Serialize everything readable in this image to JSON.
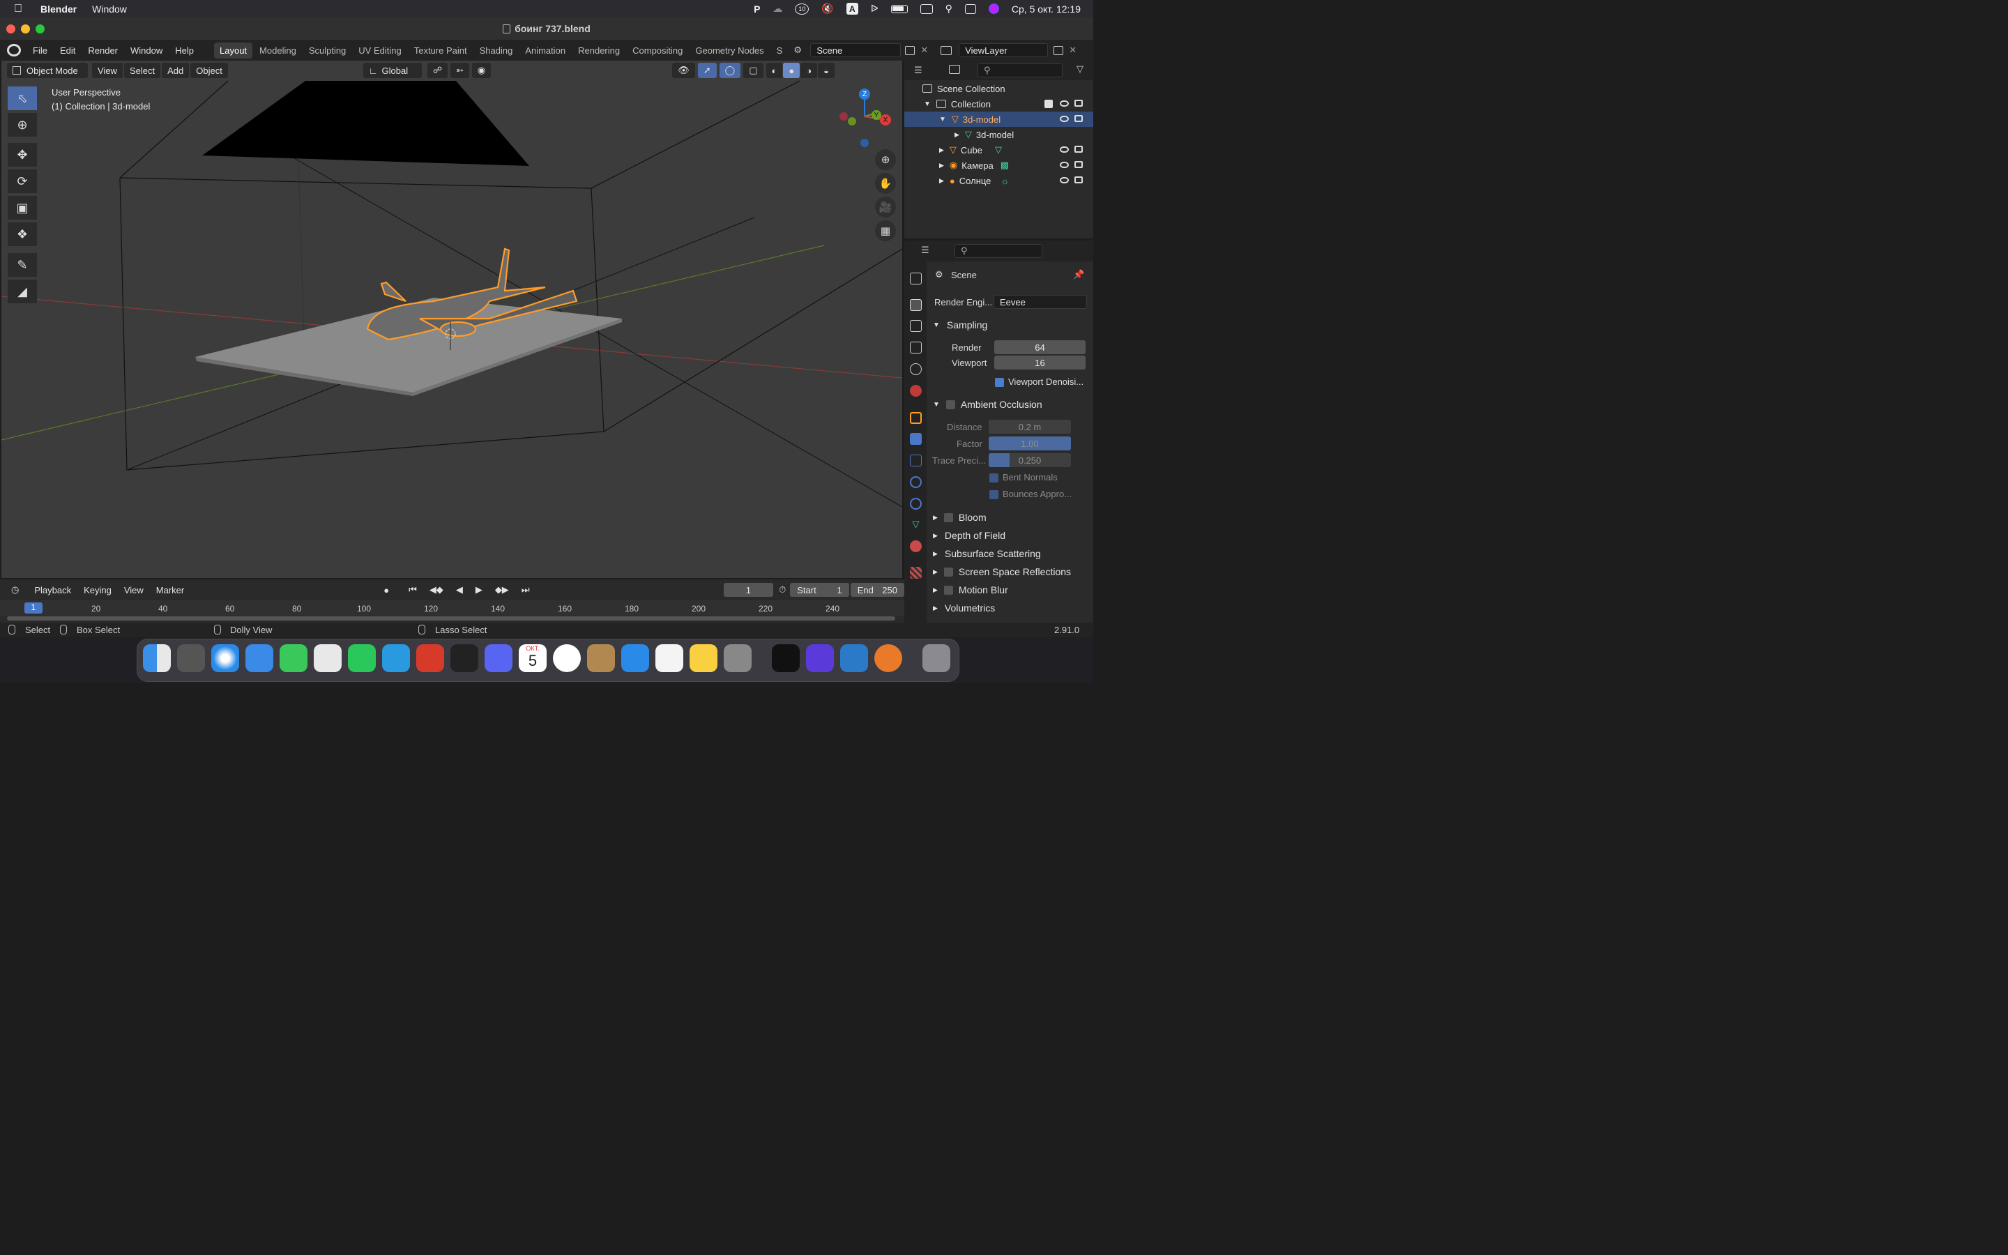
{
  "menubar": {
    "app_name": "Blender",
    "menus": [
      "Window"
    ],
    "clock": "Ср, 5 окт.  12:19",
    "tray_badge": "10",
    "input_letter": "A"
  },
  "window": {
    "title": "боинг 737.blend"
  },
  "topbar": {
    "menus": [
      "File",
      "Edit",
      "Render",
      "Window",
      "Help"
    ],
    "workspaces": [
      "Layout",
      "Modeling",
      "Sculpting",
      "UV Editing",
      "Texture Paint",
      "Shading",
      "Animation",
      "Rendering",
      "Compositing",
      "Geometry Nodes",
      "S"
    ],
    "active_workspace": "Layout",
    "scene_name": "Scene",
    "view_layer": "ViewLayer"
  },
  "viewport": {
    "mode": "Object Mode",
    "menus": [
      "View",
      "Select",
      "Add",
      "Object"
    ],
    "orientation": "Global",
    "info_line1": "User Perspective",
    "info_line2": "(1) Collection | 3d-model",
    "gizmo": {
      "z": "Z",
      "y": "Y",
      "x": "X"
    }
  },
  "outliner": {
    "root": "Scene Collection",
    "items": [
      {
        "label": "Collection",
        "depth": 1
      },
      {
        "label": "3d-model",
        "depth": 2,
        "selected": true
      },
      {
        "label": "3d-model",
        "depth": 3
      },
      {
        "label": "Cube",
        "depth": 2
      },
      {
        "label": "Камера",
        "depth": 2
      },
      {
        "label": "Солнце",
        "depth": 2
      }
    ]
  },
  "properties": {
    "context": "Scene",
    "render_engine_label": "Render Engi...",
    "render_engine": "Eevee",
    "sampling": {
      "title": "Sampling",
      "render_label": "Render",
      "render": "64",
      "viewport_label": "Viewport",
      "viewport": "16",
      "denoise_label": "Viewport Denoisi..."
    },
    "ao": {
      "title": "Ambient Occlusion",
      "distance_label": "Distance",
      "distance": "0.2 m",
      "factor_label": "Factor",
      "factor": "1.00",
      "factor_fill": 1.0,
      "trace_label": "Trace Preci...",
      "trace": "0.250",
      "trace_fill": 0.25,
      "bent_label": "Bent Normals",
      "bounces_label": "Bounces Appro..."
    },
    "sections": [
      "Bloom",
      "Depth of Field",
      "Subsurface Scattering",
      "Screen Space Reflections",
      "Motion Blur",
      "Volumetrics"
    ]
  },
  "timeline": {
    "menus": [
      "Playback",
      "Keying",
      "View",
      "Marker"
    ],
    "current_frame": "1",
    "start_label": "Start",
    "start": "1",
    "end_label": "End",
    "end": "250",
    "ruler": [
      "1",
      "20",
      "40",
      "60",
      "80",
      "100",
      "120",
      "140",
      "160",
      "180",
      "200",
      "220",
      "240"
    ]
  },
  "statusbar": {
    "items": [
      "Select",
      "Box Select",
      "Dolly View",
      "Lasso Select"
    ],
    "version": "2.91.0"
  },
  "dock": {
    "calendar_month": "ОКТ.",
    "calendar_day": "5"
  }
}
